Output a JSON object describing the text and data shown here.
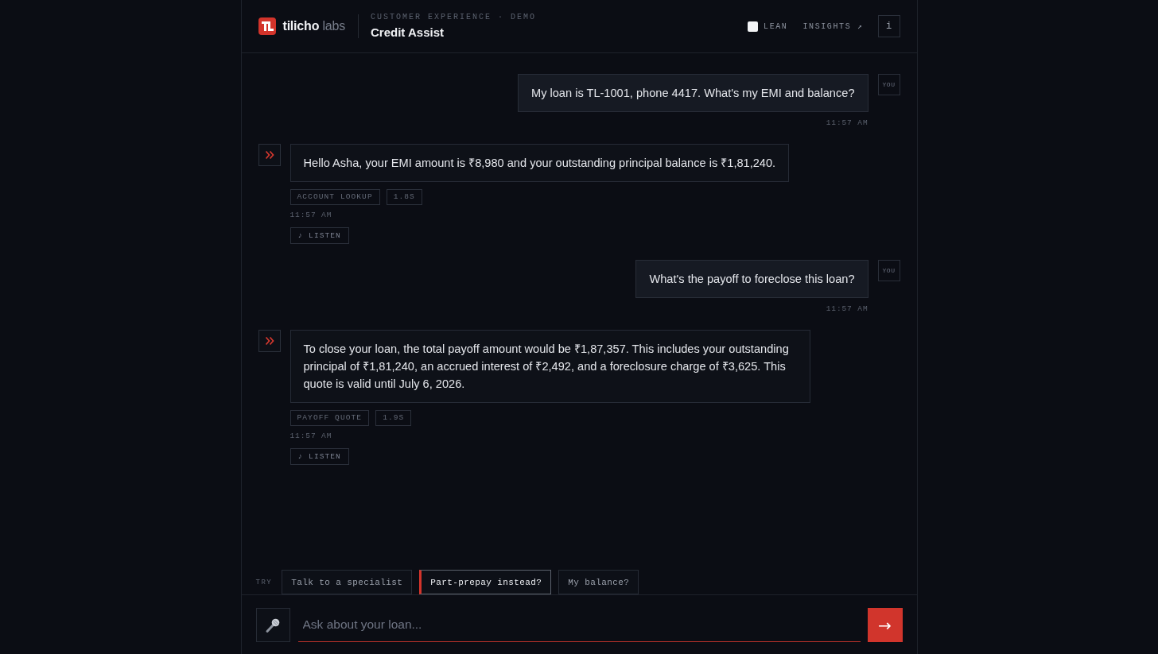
{
  "header": {
    "brand": {
      "name": "tilicho",
      "suffix": "labs"
    },
    "eyebrow": "CUSTOMER EXPERIENCE · DEMO",
    "title": "Credit Assist",
    "lean_toggle": {
      "label": "LEAN",
      "checked": false
    },
    "insights_link": "INSIGHTS ↗",
    "info_button": "i"
  },
  "messages": [
    {
      "kind": "user",
      "avatar": "YOU",
      "text": "My loan is TL-1001, phone 4417. What's my EMI and balance?",
      "time": "11:57 AM"
    },
    {
      "kind": "assistant",
      "text": "Hello Asha, your EMI amount is ₹8,980 and your outstanding principal balance is ₹1,81,240.",
      "tags": [
        "ACCOUNT LOOKUP",
        "1.8S"
      ],
      "time": "11:57 AM",
      "listen": "♪ LISTEN"
    },
    {
      "kind": "user",
      "avatar": "YOU",
      "text": "What's the payoff to foreclose this loan?",
      "time": "11:57 AM"
    },
    {
      "kind": "assistant",
      "text": "To close your loan, the total payoff amount would be ₹1,87,357. This includes your outstanding principal of ₹1,81,240, an accrued interest of ₹2,492, and a foreclosure charge of ₹3,625. This quote is valid until July 6, 2026.",
      "tags": [
        "PAYOFF QUOTE",
        "1.9S"
      ],
      "time": "11:57 AM",
      "listen": "♪ LISTEN"
    }
  ],
  "suggestions": {
    "label": "TRY",
    "items": [
      {
        "label": "Talk to a specialist",
        "selected": false
      },
      {
        "label": "Part-prepay instead?",
        "selected": true
      },
      {
        "label": "My balance?",
        "selected": false
      }
    ]
  },
  "composer": {
    "placeholder": "Ask about your loan...",
    "send": "→"
  }
}
